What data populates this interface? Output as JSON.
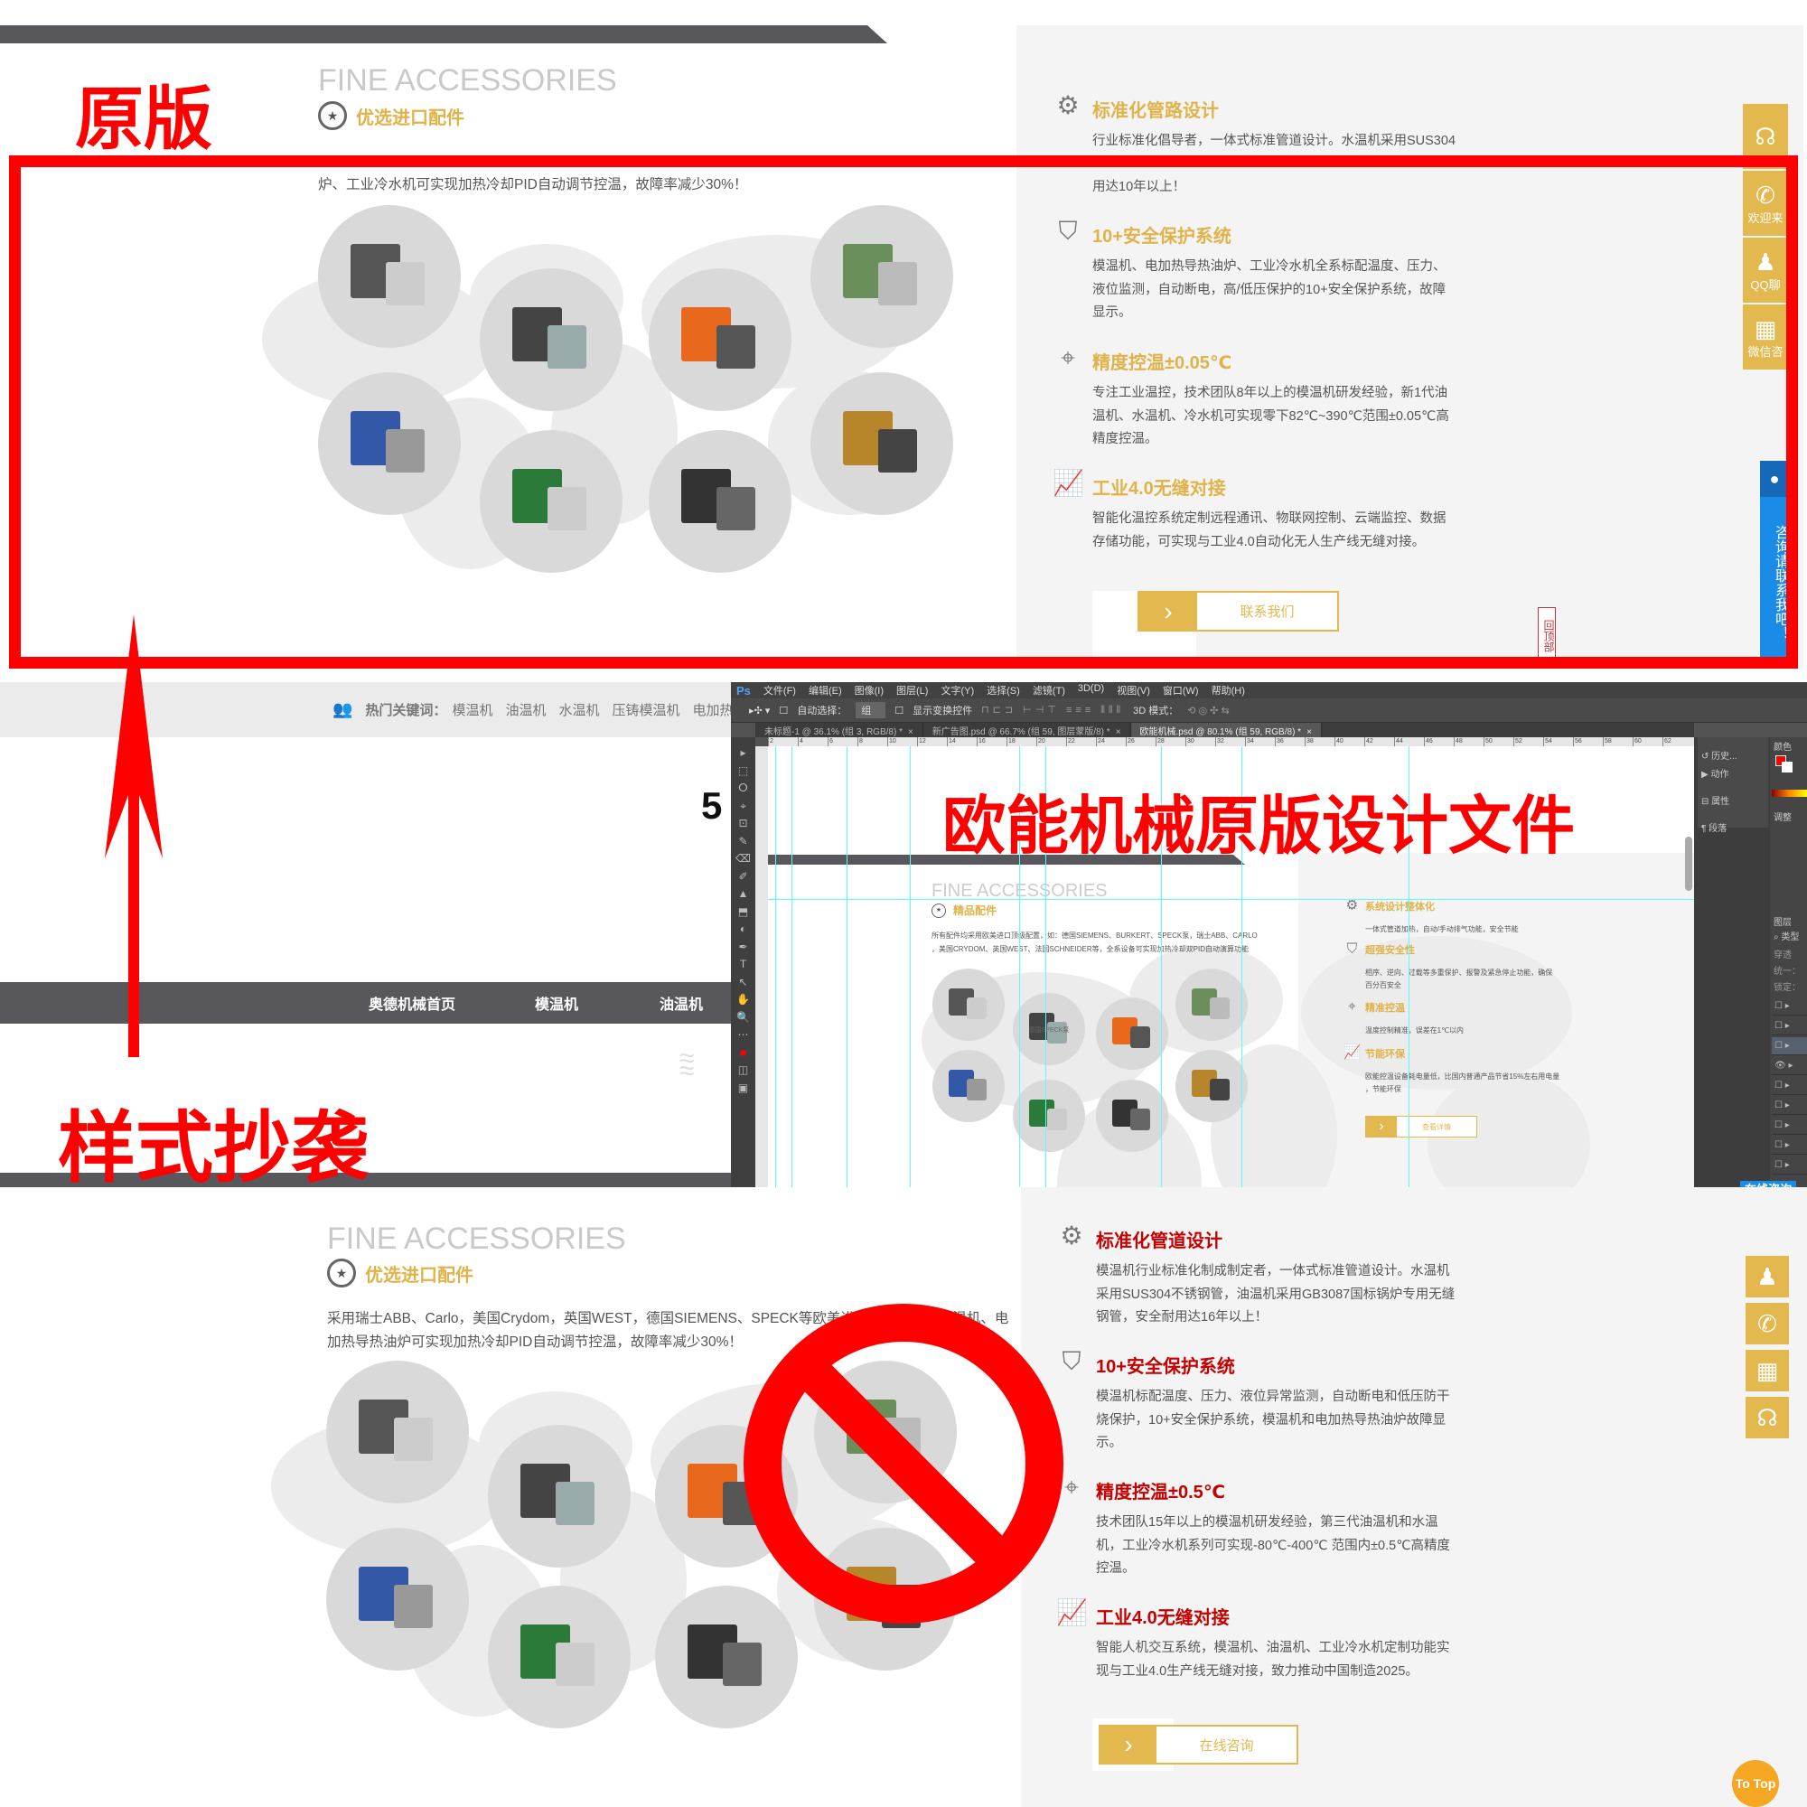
{
  "labels": {
    "original": "原版",
    "copied_style": "样式抄袭",
    "design_file": "欧能机械原版设计文件"
  },
  "colors": {
    "gold": "#e0b34a",
    "red": "#ff0000",
    "dark_red": "#c40000",
    "dark_bar": "#58575c",
    "panel": "#f4f4f4",
    "blue": "#1a8be6"
  },
  "original_site": {
    "heading_en": "FINE ACCESSORIES",
    "heading_cn": "优选进口配件",
    "intro_line": "炉、工业冷水机可实现加热冷却PID自动调节控温，故障率减少30%！",
    "features": [
      {
        "icon": "gears-icon",
        "title": "标准化管路设计",
        "lines": [
          "行业标准化倡导者，一体式标准管道设计。水温机采用SUS304",
          "",
          "用达10年以上！"
        ]
      },
      {
        "icon": "shield-bolt-icon",
        "title": "10+安全保护系统",
        "lines": [
          "模温机、电加热导热油炉、工业冷水机全系标配温度、压力、",
          "液位监测，自动断电，高/低压保护的10+安全保护系统，故障",
          "显示。"
        ]
      },
      {
        "icon": "crosshair-icon",
        "title": "精度控温±0.05℃",
        "lines": [
          "专注工业温控，技术团队8年以上的模温机研发经验，新1代油",
          "温机、水温机、冷水机可实现零下82℃~390℃范围±0.05℃高",
          "精度控温。"
        ]
      },
      {
        "icon": "line-chart-icon",
        "title": "工业4.0无缝对接",
        "lines": [
          "智能化温控系统定制远程通讯、物联网控制、云端监控、数据",
          "存储功能，可实现与工业4.0自动化无人生产线无缝对接。"
        ]
      }
    ],
    "button_label": "联系我们",
    "back_to_top": "回顶部",
    "side_widget": [
      {
        "icon": "headset-icon",
        "label": ""
      },
      {
        "icon": "phone-icon",
        "label": "欢迎来"
      },
      {
        "icon": "qq-icon",
        "label": "QQ聊"
      },
      {
        "icon": "qr-code-icon",
        "label": "微信咨"
      }
    ],
    "chat_tab": "咨询请联系我吧！"
  },
  "copy_site_middle": {
    "keywords_label": "热门关键词：",
    "keywords": [
      "模温机",
      "油温机",
      "水温机",
      "压铸模温机",
      "电加热导"
    ],
    "big_number": "5",
    "nav": [
      "奥德机械首页",
      "模温机",
      "油温机"
    ],
    "online_tab": "在线咨询"
  },
  "photoshop": {
    "logo": "Ps",
    "menu": [
      "文件(F)",
      "编辑(E)",
      "图像(I)",
      "图层(L)",
      "文字(Y)",
      "选择(S)",
      "滤镜(T)",
      "3D(D)",
      "视图(V)",
      "窗口(W)",
      "帮助(H)"
    ],
    "options": {
      "auto_select": "自动选择：",
      "auto_select_value": "组",
      "show_transform": "显示变换控件",
      "mode_3d": "3D 模式："
    },
    "tabs": [
      "未标题-1 @ 36.1% (组 3, RGB/8) *",
      "新广告图.psd @ 66.7% (组 59, 图层蒙版/8) *",
      "欧能机械.psd @ 80.1% (组 59, RGB/8) *"
    ],
    "active_tab": 2,
    "ruler": [
      "2",
      "4",
      "6",
      "8",
      "10",
      "12",
      "14",
      "16",
      "18",
      "20",
      "22",
      "24",
      "26",
      "28",
      "30",
      "32",
      "34",
      "36",
      "38",
      "40",
      "42",
      "44",
      "46",
      "48",
      "50",
      "52",
      "54",
      "56",
      "58",
      "60",
      "62"
    ],
    "panels": {
      "history": "历史...",
      "actions": "动作",
      "properties": "属性",
      "paragraph": "段落",
      "color": "颜色",
      "adjust": "调整",
      "layers": "图层",
      "kind": "类型",
      "blend": "穿透",
      "unify": "统一：",
      "lock": "锁定："
    },
    "canvas": {
      "heading_en": "FINE ACCESSORIES",
      "heading_cn": "精品配件",
      "intro_lines": [
        "所有配件均采用欧美进口顶级配置，如：德国SIEMENS、BURKERT、SPECK泵，瑞士ABB、CARLO",
        "，美国CRYDOM、英国WEST、法国SCHNEIDER等，全系设备可实现加热冷却双PID自动演算功能"
      ],
      "circle_label": "德国SPECK泵",
      "features": [
        {
          "icon": "gears-icon",
          "title": "系统设计整体化",
          "lines": [
            "一体式管道加热，自动/手动排气功能，安全节能"
          ]
        },
        {
          "icon": "shield-bolt-icon",
          "title": "超强安全性",
          "lines": [
            "相序、逆向、过载等多重保护、报警及紧急停止功能，确保",
            "百分百安全"
          ]
        },
        {
          "icon": "crosshair-icon",
          "title": "精准控温",
          "lines": [
            "温度控制精准，误差在1℃以内"
          ]
        },
        {
          "icon": "line-chart-icon",
          "title": "节能环保",
          "lines": [
            "欧能控温设备耗电量低，比国内普通产品节省15%左右用电量",
            "，节能环保"
          ]
        }
      ],
      "button_label": "查看详情"
    }
  },
  "copy_site_bottom": {
    "heading_en": "FINE ACCESSORIES",
    "heading_cn": "优选进口配件",
    "intro_lines": [
      "采用瑞士ABB、Carlo，美国Crydom，英国WEST，德国SIEMENS、SPECK等欧美进口品牌配件，模温机、电",
      "加热导热油炉可实现加热冷却PID自动调节控温，故障率减少30%！"
    ],
    "features": [
      {
        "icon": "gears-icon",
        "title": "标准化管道设计",
        "lines": [
          "模温机行业标准化制成制定者，一体式标准管道设计。水温机",
          "采用SUS304不锈钢管，油温机采用GB3087国标锅炉专用无缝",
          "钢管，安全耐用达16年以上！"
        ]
      },
      {
        "icon": "shield-bolt-icon",
        "title": "10+安全保护系统",
        "lines": [
          "模温机标配温度、压力、液位异常监测，自动断电和低压防干",
          "烧保护，10+安全保护系统，模温机和电加热导热油炉故障显",
          "示。"
        ]
      },
      {
        "icon": "crosshair-icon",
        "title": "精度控温±0.5℃",
        "lines": [
          "技术团队15年以上的模温机研发经验，第三代油温机和水温",
          "机，工业冷水机系列可实现-80℃-400℃ 范围内±0.5℃高精度",
          "控温。"
        ]
      },
      {
        "icon": "line-chart-icon",
        "title": "工业4.0无缝对接",
        "lines": [
          "智能人机交互系统，模温机、油温机、工业冷水机定制功能实",
          "现与工业4.0生产线无缝对接，致力推动中国制造2025。"
        ]
      }
    ],
    "button_label": "在线咨询",
    "side_widget": [
      {
        "icon": "qq-icon"
      },
      {
        "icon": "phone-icon"
      },
      {
        "icon": "qr-code-icon"
      },
      {
        "icon": "headset-icon"
      }
    ],
    "to_top": "To Top"
  }
}
